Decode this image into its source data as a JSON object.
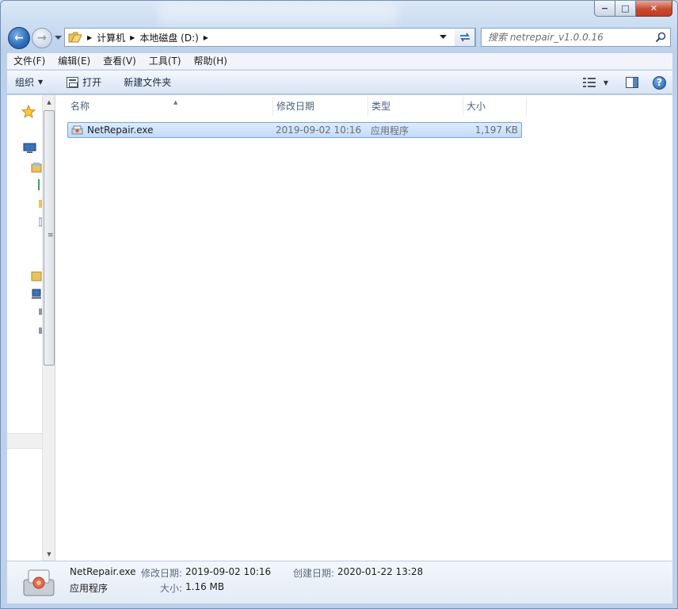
{
  "window": {
    "minimize_label": "−",
    "maximize_label": "□",
    "close_label": "✕"
  },
  "address": {
    "crumbs": [
      "计算机",
      "本地磁盘 (D:)"
    ]
  },
  "search": {
    "placeholder": "搜索 netrepair_v1.0.0.16"
  },
  "menu": [
    "文件(F)",
    "编辑(E)",
    "查看(V)",
    "工具(T)",
    "帮助(H)"
  ],
  "toolbar": {
    "organize": "组织",
    "open": "打开",
    "new_folder": "新建文件夹"
  },
  "columns": [
    "名称",
    "修改日期",
    "类型",
    "大小"
  ],
  "files": [
    {
      "name": "NetRepair.exe",
      "modified": "2019-09-02 10:16",
      "type": "应用程序",
      "size": "1,197 KB"
    }
  ],
  "details": {
    "name": "NetRepair.exe",
    "type": "应用程序",
    "modified_label": "修改日期:",
    "modified": "2019-09-02 10:16",
    "created_label": "创建日期:",
    "created": "2020-01-22 13:28",
    "size_label": "大小:",
    "size": "1.16 MB"
  },
  "colors": {
    "selection": "#cce4fc",
    "accent": "#2a6bb8",
    "close": "#c74a31"
  }
}
